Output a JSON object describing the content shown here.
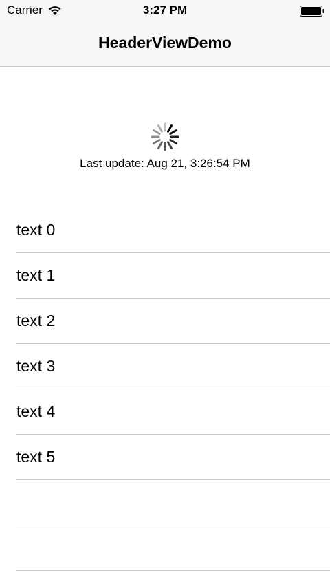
{
  "status_bar": {
    "carrier": "Carrier",
    "time": "3:27 PM",
    "icons": [
      "wifi-icon",
      "battery-icon"
    ]
  },
  "nav_bar": {
    "title": "HeaderViewDemo"
  },
  "refresh_header": {
    "icon": "activity-spinner-icon",
    "last_update": "Last update: Aug 21, 3:26:54 PM"
  },
  "table": {
    "rows": [
      {
        "label": "text 0"
      },
      {
        "label": "text 1"
      },
      {
        "label": "text 2"
      },
      {
        "label": "text 3"
      },
      {
        "label": "text 4"
      },
      {
        "label": "text 5"
      },
      {
        "label": ""
      },
      {
        "label": ""
      }
    ]
  }
}
